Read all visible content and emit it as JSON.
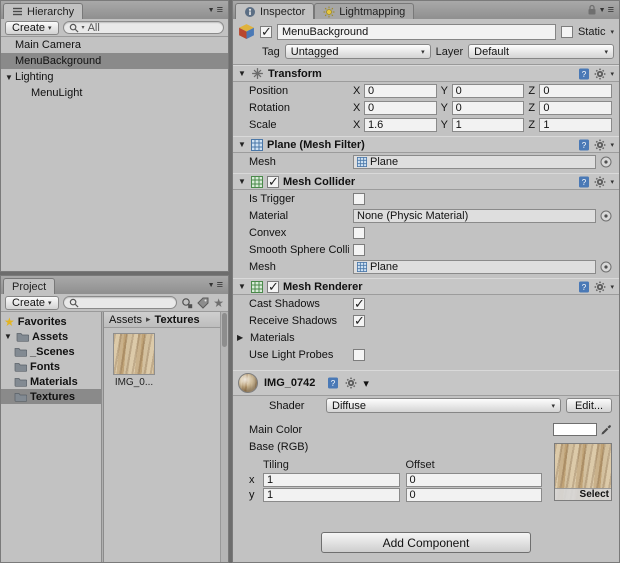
{
  "icons": {
    "caret_down": "▾",
    "menu_tri": "▼",
    "hamburger": "≡",
    "foldout_open": "▼",
    "foldout_closed": "▶",
    "breadcrumb_sep": "▸",
    "star": "★"
  },
  "hierarchy": {
    "tab_label": "Hierarchy",
    "create_label": "Create",
    "search_text": "All",
    "items": [
      {
        "label": "Main Camera",
        "selected": false
      },
      {
        "label": "MenuBackground",
        "selected": true
      },
      {
        "label": "Lighting",
        "selected": false,
        "expanded": true
      },
      {
        "label": "MenuLight",
        "selected": false,
        "child": true
      }
    ]
  },
  "project": {
    "tab_label": "Project",
    "create_label": "Create",
    "search_text": "",
    "favorites_label": "Favorites",
    "assets_root_label": "Assets",
    "folders": [
      {
        "label": "_Scenes",
        "selected": false
      },
      {
        "label": "Fonts",
        "selected": false
      },
      {
        "label": "Materials",
        "selected": false
      },
      {
        "label": "Textures",
        "selected": true
      }
    ],
    "breadcrumb": {
      "root": "Assets",
      "current": "Textures"
    },
    "asset_caption": "IMG_0..."
  },
  "inspector": {
    "tab_label": "Inspector",
    "lightmapping_tab_label": "Lightmapping",
    "gameobject": {
      "active": true,
      "name_value": "MenuBackground",
      "static_label": "Static",
      "static_checked": false,
      "tag_label": "Tag",
      "tag_value": "Untagged",
      "layer_label": "Layer",
      "layer_value": "Default"
    },
    "transform": {
      "title": "Transform",
      "axis_labels": {
        "x": "X",
        "y": "Y",
        "z": "Z"
      },
      "rows": [
        {
          "label": "Position",
          "x": "0",
          "y": "0",
          "z": "0"
        },
        {
          "label": "Rotation",
          "x": "0",
          "y": "0",
          "z": "0"
        },
        {
          "label": "Scale",
          "x": "1.6",
          "y": "1",
          "z": "1"
        }
      ]
    },
    "mesh_filter": {
      "title": "Plane (Mesh Filter)",
      "mesh_label": "Mesh",
      "mesh_value": "Plane"
    },
    "mesh_collider": {
      "title": "Mesh Collider",
      "enabled": true,
      "is_trigger_label": "Is Trigger",
      "is_trigger_checked": false,
      "material_label": "Material",
      "material_value": "None (Physic Material)",
      "convex_label": "Convex",
      "convex_checked": false,
      "smooth_label": "Smooth Sphere Collision",
      "smooth_checked": false,
      "mesh_label": "Mesh",
      "mesh_value": "Plane"
    },
    "mesh_renderer": {
      "title": "Mesh Renderer",
      "enabled": true,
      "cast_shadows_label": "Cast Shadows",
      "cast_shadows_checked": true,
      "receive_shadows_label": "Receive Shadows",
      "receive_shadows_checked": true,
      "materials_label": "Materials",
      "use_light_probes_label": "Use Light Probes",
      "use_light_probes_checked": false
    },
    "material": {
      "name": "IMG_0742",
      "shader_label": "Shader",
      "shader_value": "Diffuse",
      "edit_button_label": "Edit...",
      "main_color_label": "Main Color",
      "main_color_value": "#FFFFFF",
      "base_label": "Base (RGB)",
      "tiling_label": "Tiling",
      "offset_label": "Offset",
      "x_label": "x",
      "y_label": "y",
      "tiling_x": "1",
      "tiling_y": "1",
      "offset_x": "0",
      "offset_y": "0",
      "select_label": "Select"
    },
    "add_component_label": "Add Component"
  }
}
